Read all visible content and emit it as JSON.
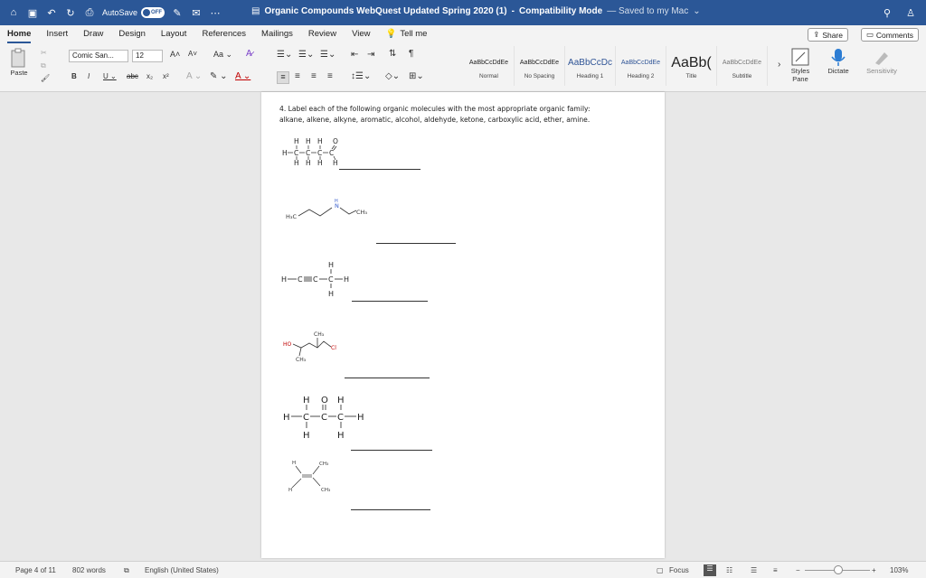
{
  "titlebar": {
    "autosave_label": "AutoSave",
    "autosave_state": "OFF",
    "doc_title": "Organic Compounds WebQuest Updated Spring 2020 (1)",
    "separator": "-",
    "mode": "Compatibility Mode",
    "saved_status": "— Saved to my Mac"
  },
  "tabs": [
    "Home",
    "Insert",
    "Draw",
    "Design",
    "Layout",
    "References",
    "Mailings",
    "Review",
    "View"
  ],
  "tellme": "Tell me",
  "share_label": "Share",
  "comments_label": "Comments",
  "ribbon": {
    "paste_label": "Paste",
    "font_name": "Comic San...",
    "font_size": "12",
    "styles": [
      {
        "sample": "AaBbCcDdEe",
        "label": "Normal"
      },
      {
        "sample": "AaBbCcDdEe",
        "label": "No Spacing"
      },
      {
        "sample": "AaBbCcDc",
        "label": "Heading 1"
      },
      {
        "sample": "AaBbCcDdEe",
        "label": "Heading 2"
      },
      {
        "sample": "AaBb(",
        "label": "Title"
      },
      {
        "sample": "AaBbCcDdEe",
        "label": "Subtitle"
      }
    ],
    "styles_pane_label": "Styles Pane",
    "dictate_label": "Dictate",
    "sensitivity_label": "Sensitivity"
  },
  "document": {
    "question_line1": "4. Label each of the following organic molecules with the most appropriate organic family:",
    "question_line2": "alkane, alkene, alkyne, aromatic, alcohol, aldehyde, ketone, carboxylic acid, ether, amine.",
    "mol_labels": {
      "h3c": "H₃C",
      "ch3": "CH₃",
      "n": "N",
      "h": "H",
      "ho": "HO",
      "cl": "Cl",
      "o": "O",
      "c": "C"
    }
  },
  "statusbar": {
    "page": "Page 4 of 11",
    "words": "802 words",
    "language": "English (United States)",
    "focus": "Focus",
    "zoom": "103%"
  },
  "colors": {
    "titlebar": "#2b5797",
    "heteroatom": "#c00000",
    "nitrogen": "#3a5fcd"
  }
}
